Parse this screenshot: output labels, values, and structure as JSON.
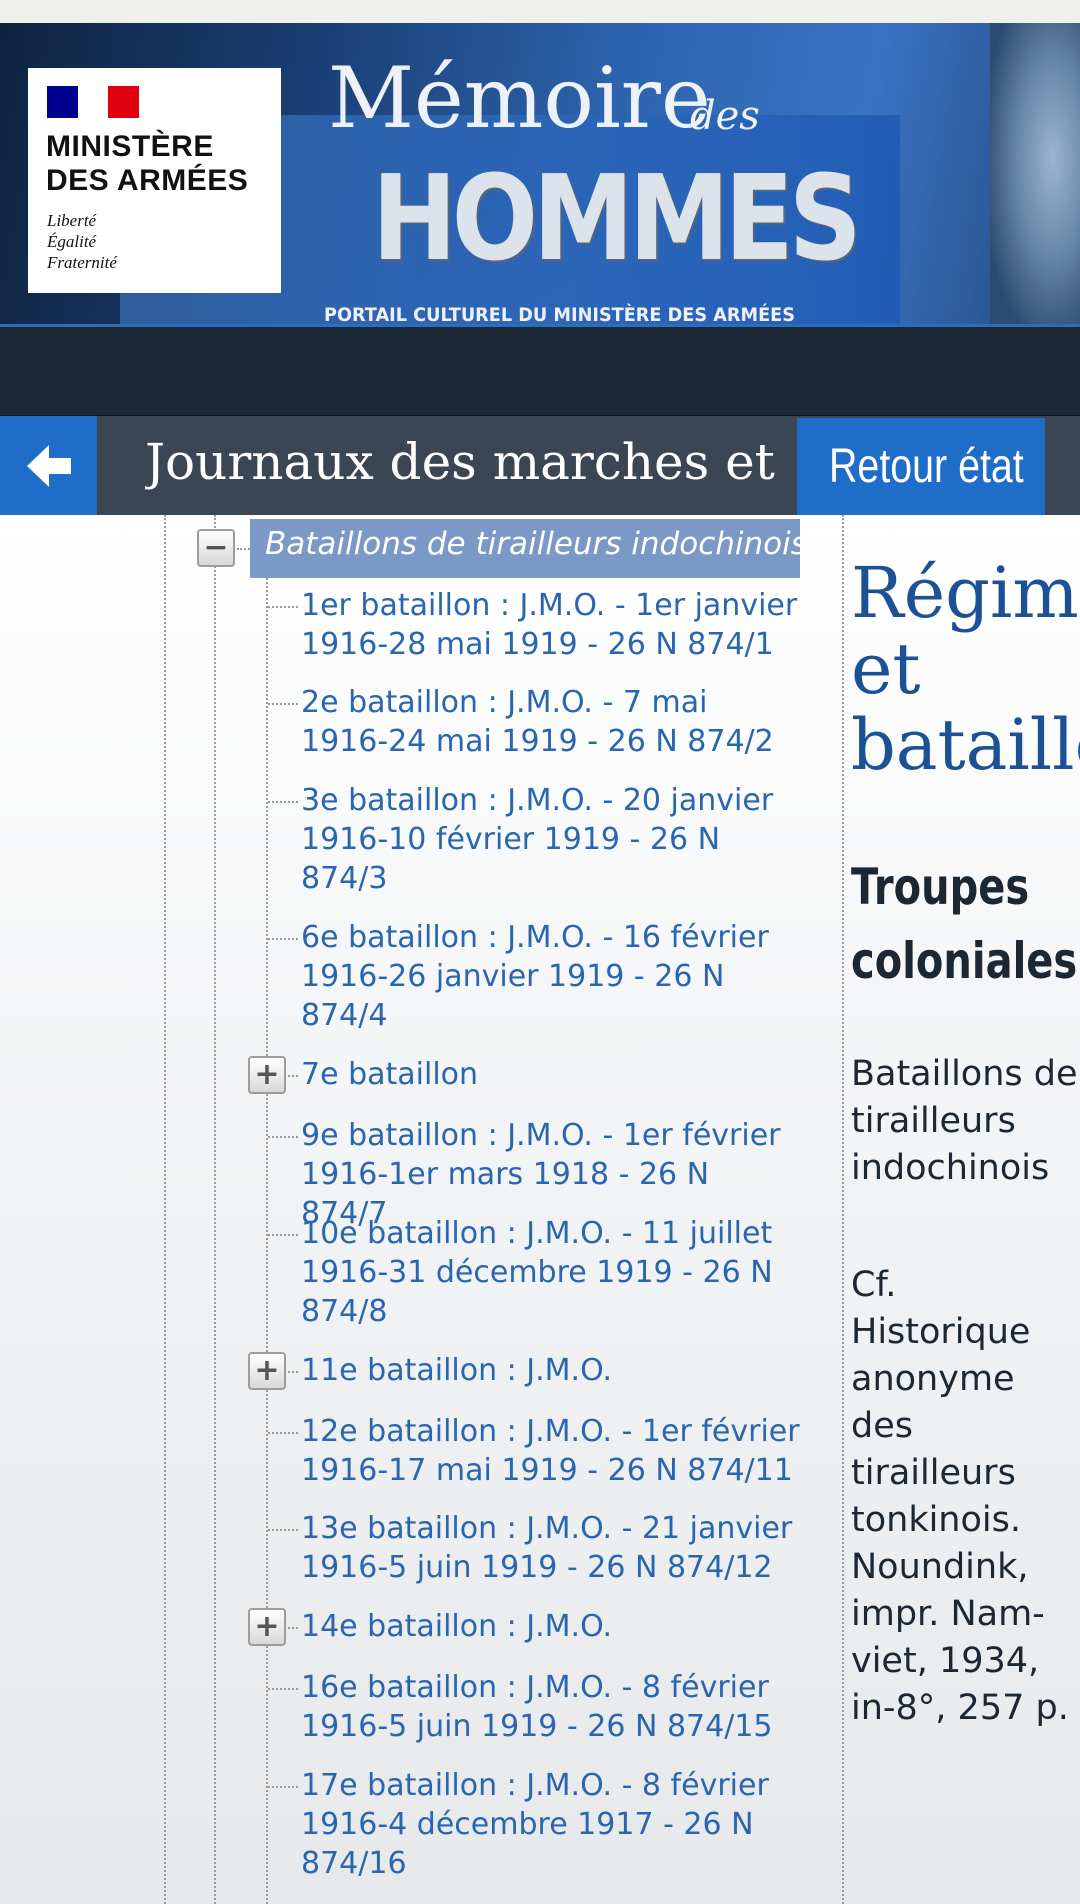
{
  "banner": {
    "ministry_line1": "MINISTÈRE",
    "ministry_line2": "DES ARMÉES",
    "motto_1": "Liberté",
    "motto_2": "Égalité",
    "motto_3": "Fraternité",
    "site_title_1": "Mémoire",
    "site_title_2": "des",
    "site_title_3": "HOMMES",
    "tagline": "PORTAIL CULTUREL DU MINISTÈRE DES ARMÉES"
  },
  "toolbar": {
    "back_icon": "arrow-left-icon",
    "title": "Journaux des marches et",
    "retour_label": "Retour état"
  },
  "tree": {
    "group_label": "Bataillons de tirailleurs indochinois",
    "items": [
      {
        "label": "1er bataillon : J.M.O. - 1er janvier 1916-28 mai 1919 - 26 N 874/1",
        "expandable": false
      },
      {
        "label": "2e bataillon : J.M.O. - 7 mai 1916-24 mai 1919 - 26 N 874/2",
        "expandable": false
      },
      {
        "label": "3e bataillon : J.M.O. - 20 janvier 1916-10 février 1919 - 26 N 874/3",
        "expandable": false
      },
      {
        "label": "6e bataillon : J.M.O. - 16 février 1916-26 janvier 1919 - 26 N 874/4",
        "expandable": false
      },
      {
        "label": "7e bataillon",
        "expandable": true
      },
      {
        "label": "9e bataillon : J.M.O. - 1er février 1916-1er mars 1918 - 26 N 874/7",
        "expandable": false
      },
      {
        "label": "10e bataillon : J.M.O. - 11 juillet 1916-31 décembre 1919 - 26 N 874/8",
        "expandable": false
      },
      {
        "label": "11e bataillon : J.M.O.",
        "expandable": true
      },
      {
        "label": "12e bataillon : J.M.O. - 1er février 1916-17 mai 1919 - 26 N 874/11",
        "expandable": false
      },
      {
        "label": "13e bataillon : J.M.O. - 21 janvier 1916-5 juin 1919 - 26 N 874/12",
        "expandable": false
      },
      {
        "label": "14e bataillon : J.M.O.",
        "expandable": true
      },
      {
        "label": "16e bataillon : J.M.O. - 8 février 1916-5 juin 1919 - 26 N 874/15",
        "expandable": false
      },
      {
        "label": "17e bataillon : J.M.O. - 8 février 1916-4 décembre 1917 - 26 N 874/16",
        "expandable": false
      }
    ]
  },
  "right_panel": {
    "title_1": "Régime",
    "title_2": "et",
    "title_3": "bataillo",
    "subtitle_1": "Troupes",
    "subtitle_2": "coloniales",
    "group_name": "Bataillons de tirailleurs indochinois",
    "note": "Cf. Historique anonyme des tirailleurs tonkinois. Noundink, impr. Nam-viet, 1934, in-8°, 257 p."
  },
  "colors": {
    "accent_blue": "#1f6cc9",
    "link_blue": "#2a66b0",
    "selected_bg": "#7b98c7",
    "toolbar_bg": "#3a4654"
  }
}
